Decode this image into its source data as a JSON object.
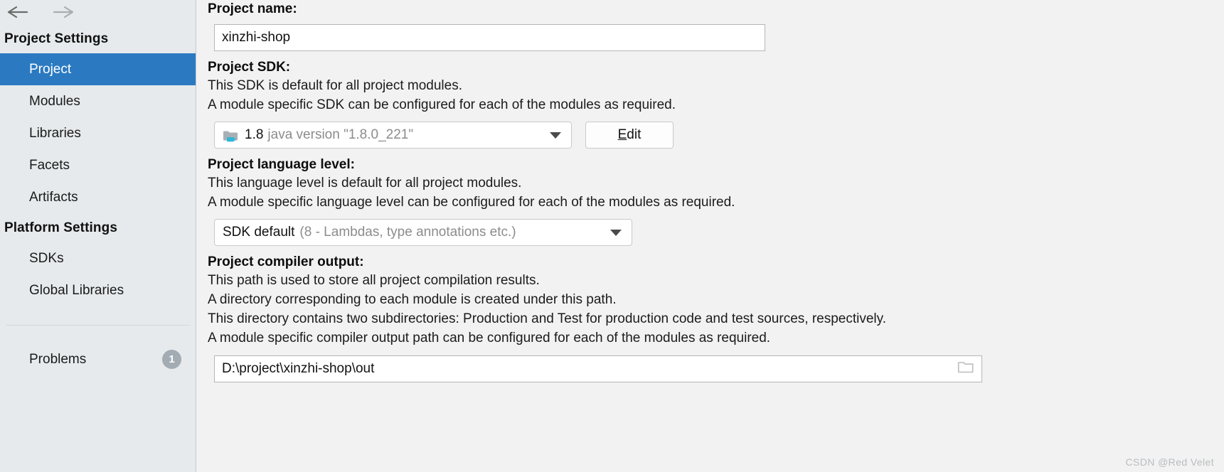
{
  "sidebar": {
    "back_icon": "arrow-left-icon",
    "forward_icon": "arrow-right-icon",
    "groups": [
      {
        "title": "Project Settings",
        "items": [
          {
            "label": "Project",
            "selected": true
          },
          {
            "label": "Modules",
            "selected": false
          },
          {
            "label": "Libraries",
            "selected": false
          },
          {
            "label": "Facets",
            "selected": false
          },
          {
            "label": "Artifacts",
            "selected": false
          }
        ]
      },
      {
        "title": "Platform Settings",
        "items": [
          {
            "label": "SDKs",
            "selected": false
          },
          {
            "label": "Global Libraries",
            "selected": false
          }
        ]
      }
    ],
    "problems": {
      "label": "Problems",
      "count": "1"
    },
    "selected_bg": "#2b7ac1",
    "background": "#e6eaed"
  },
  "main": {
    "project_name": {
      "label": "Project name:",
      "value": "xinzhi-shop",
      "placeholder": ""
    },
    "project_sdk": {
      "label": "Project SDK:",
      "descriptions": [
        "This SDK is default for all project modules.",
        "A module specific SDK can be configured for each of the modules as required."
      ],
      "icon": "java-sdk-folder-icon",
      "value_strong": "1.8",
      "value_muted": "java version \"1.8.0_221\"",
      "edit_button": {
        "mnemonic": "E",
        "rest": "dit"
      }
    },
    "language_level": {
      "label": "Project language level:",
      "descriptions": [
        "This language level is default for all project modules.",
        "A module specific language level can be configured for each of the modules as required."
      ],
      "value_strong": "SDK default",
      "value_muted": "(8 - Lambdas, type annotations etc.)"
    },
    "compiler_output": {
      "label": "Project compiler output:",
      "descriptions": [
        "This path is used to store all project compilation results.",
        "A directory corresponding to each module is created under this path.",
        "This directory contains two subdirectories: Production and Test for production code and test sources, respectively.",
        "A module specific compiler output path can be configured for each of the modules as required."
      ],
      "value": "D:\\project\\xinzhi-shop\\out",
      "browse_icon": "folder-browse-icon"
    }
  },
  "watermark": "CSDN @Red Velet"
}
